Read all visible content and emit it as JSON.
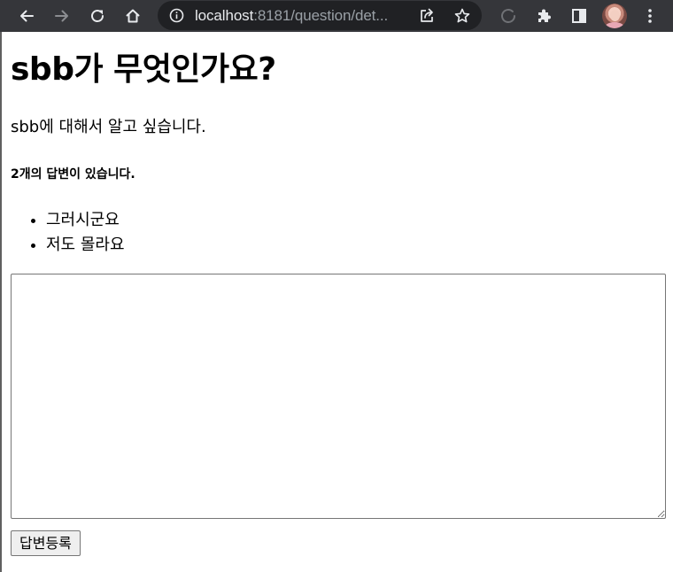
{
  "browser": {
    "url_host": "localhost",
    "url_path": ":8181/question/det...",
    "icons": [
      "back-icon",
      "forward-icon",
      "reload-icon",
      "home-icon",
      "site-info-icon",
      "share-icon",
      "star-icon",
      "loading-icon",
      "extensions-icon",
      "side-panel-icon",
      "avatar",
      "menu-icon"
    ]
  },
  "question": {
    "subject": "sbb가 무엇인가요?",
    "content": "sbb에 대해서 알고 싶습니다."
  },
  "answers": {
    "count_label": "2개의 답변이 있습니다.",
    "items": [
      {
        "content": "그러시군요"
      },
      {
        "content": "저도 몰라요"
      }
    ]
  },
  "form": {
    "textarea_value": "",
    "submit_label": "답변등록"
  },
  "colors": {
    "toolbar_bg": "#35363a",
    "omnibox_bg": "#202124",
    "url_text": "#e8eaed",
    "url_path_text": "#9aa0a6"
  }
}
